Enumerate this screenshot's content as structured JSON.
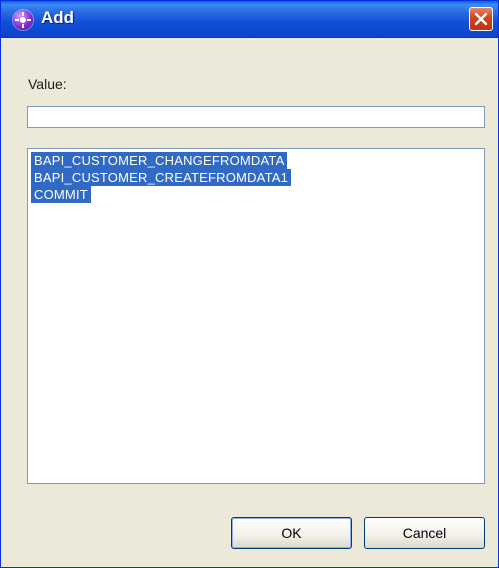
{
  "window": {
    "title": "Add"
  },
  "form": {
    "value_label": "Value:",
    "value_input": "",
    "value_placeholder": ""
  },
  "list": {
    "items": [
      {
        "label": "BAPI_CUSTOMER_CHANGEFROMDATA",
        "selected": true
      },
      {
        "label": "BAPI_CUSTOMER_CREATEFROMDATA1",
        "selected": true
      },
      {
        "label": "COMMIT",
        "selected": true
      }
    ]
  },
  "buttons": {
    "ok_label": "OK",
    "cancel_label": "Cancel"
  },
  "icons": {
    "app": "app-icon",
    "close": "close-icon"
  },
  "colors": {
    "titlebar": "#0a44c8",
    "dialog_bg": "#ece9d8",
    "selection": "#316ac5",
    "close_button": "#d2421f"
  }
}
